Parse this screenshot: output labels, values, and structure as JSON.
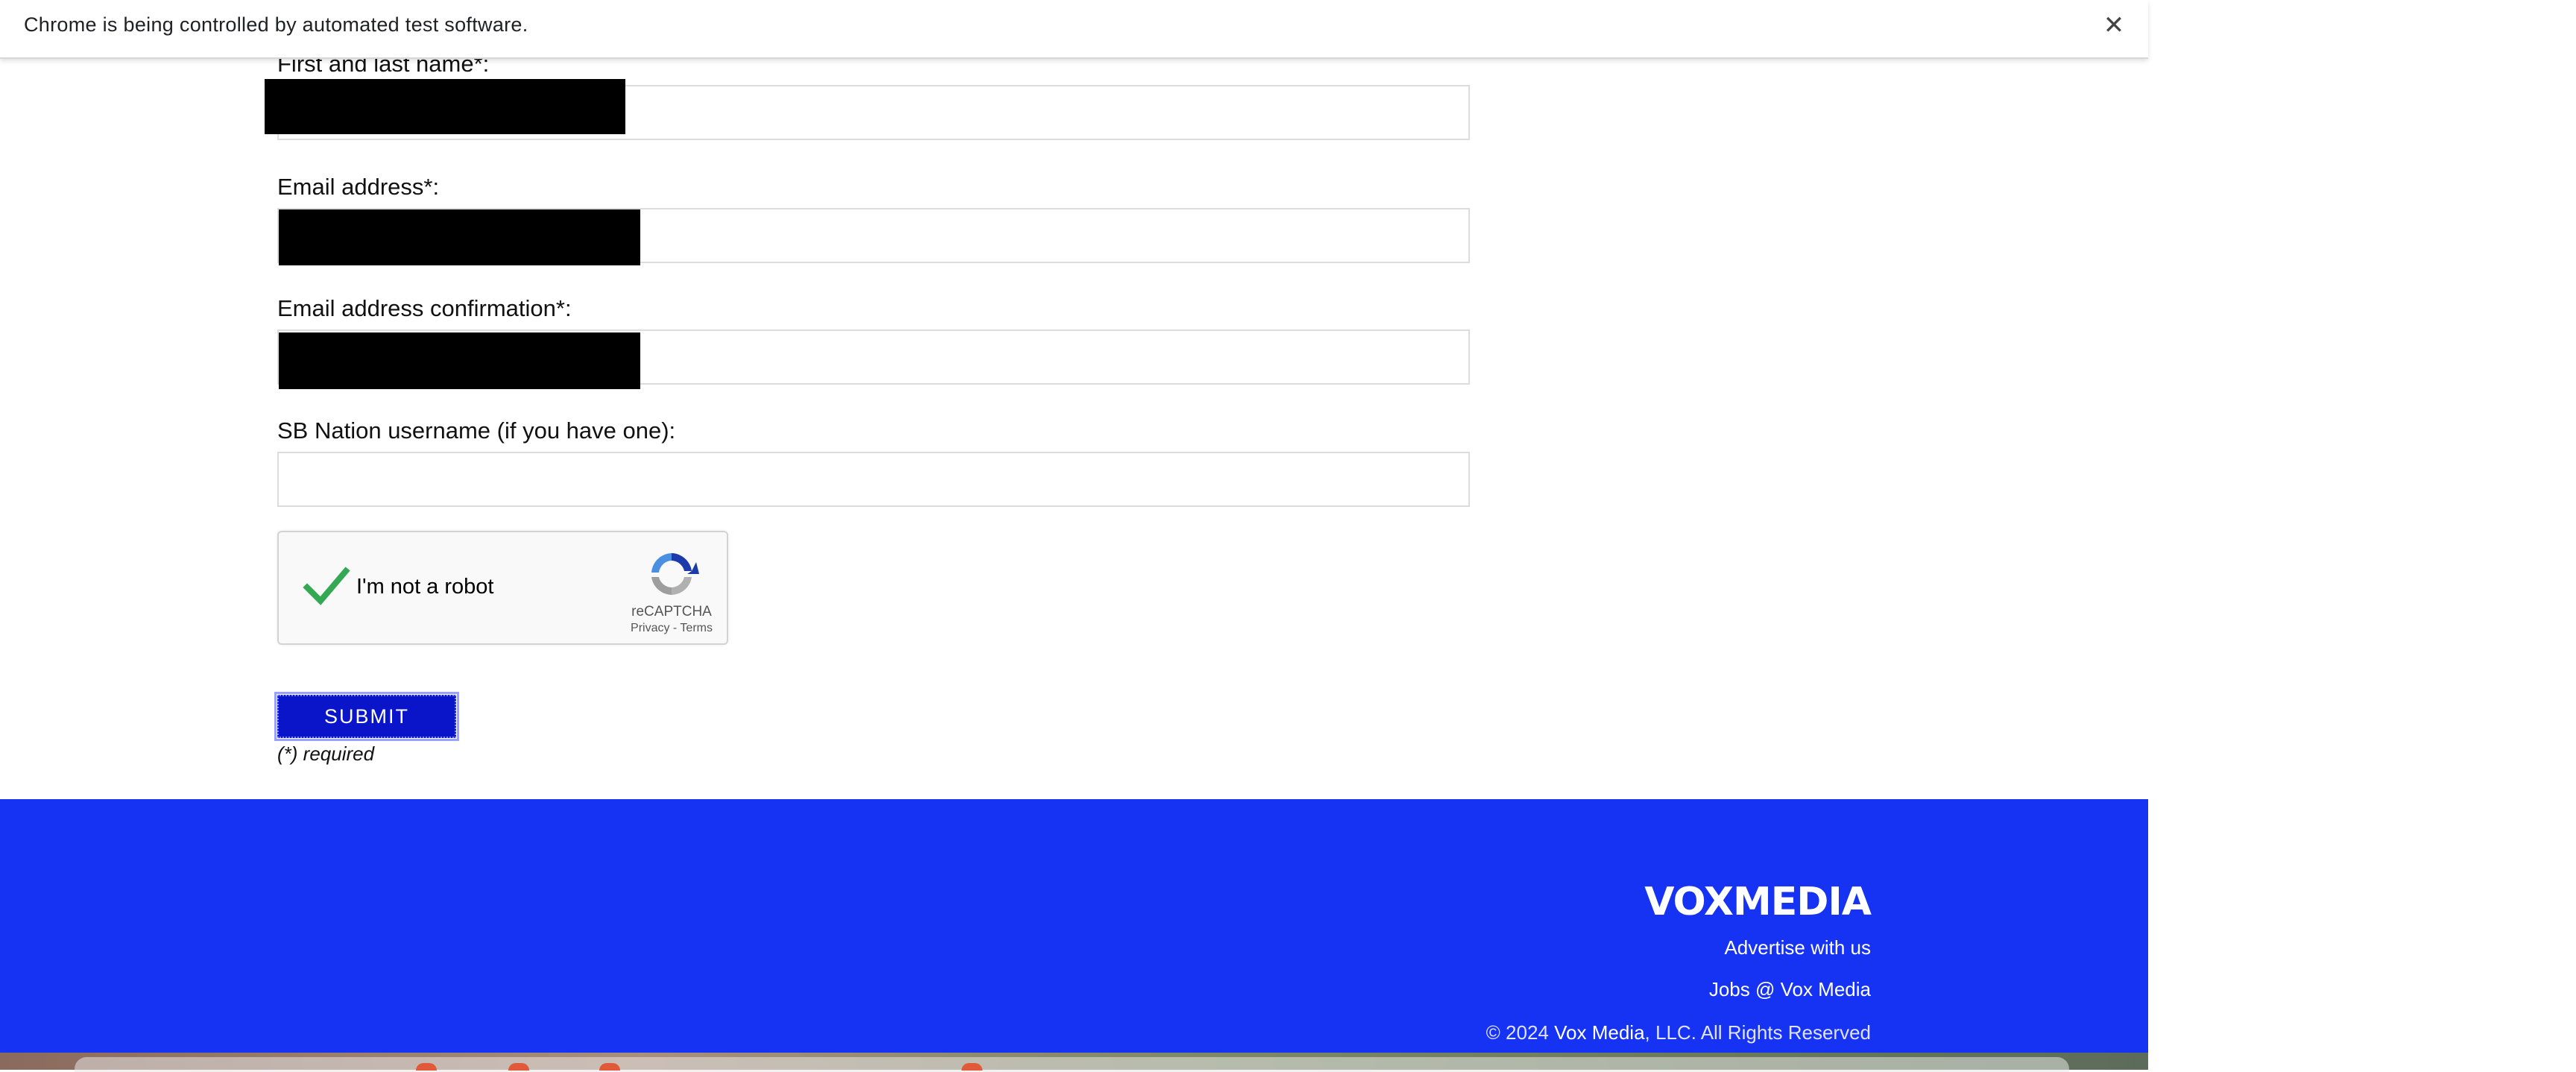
{
  "infobar": {
    "message": "Chrome is being controlled by automated test software.",
    "close_glyph": "✕"
  },
  "form": {
    "name_label": "First and last name*:",
    "email_label": "Email address*:",
    "email_confirm_label": "Email address confirmation*:",
    "username_label": "SB Nation username (if you have one):",
    "username_value": "",
    "recaptcha": {
      "checkbox_label": "I'm not a robot",
      "brand": "reCAPTCHA",
      "links": "Privacy - Terms",
      "checked": true
    },
    "submit_label": "SUBMIT",
    "required_note": "(*) required"
  },
  "footer": {
    "logo": "VOXMEDIA",
    "advertise_link": "Advertise with us",
    "jobs_link": "Jobs @ Vox Media",
    "copyright_prefix": "© 2024 ",
    "copyright_company": "Vox Media",
    "copyright_suffix": ", LLC. All Rights Reserved",
    "background_color": "#1632f3"
  },
  "colors": {
    "submit_button": "#0a14c8",
    "checkmark": "#34a853"
  }
}
